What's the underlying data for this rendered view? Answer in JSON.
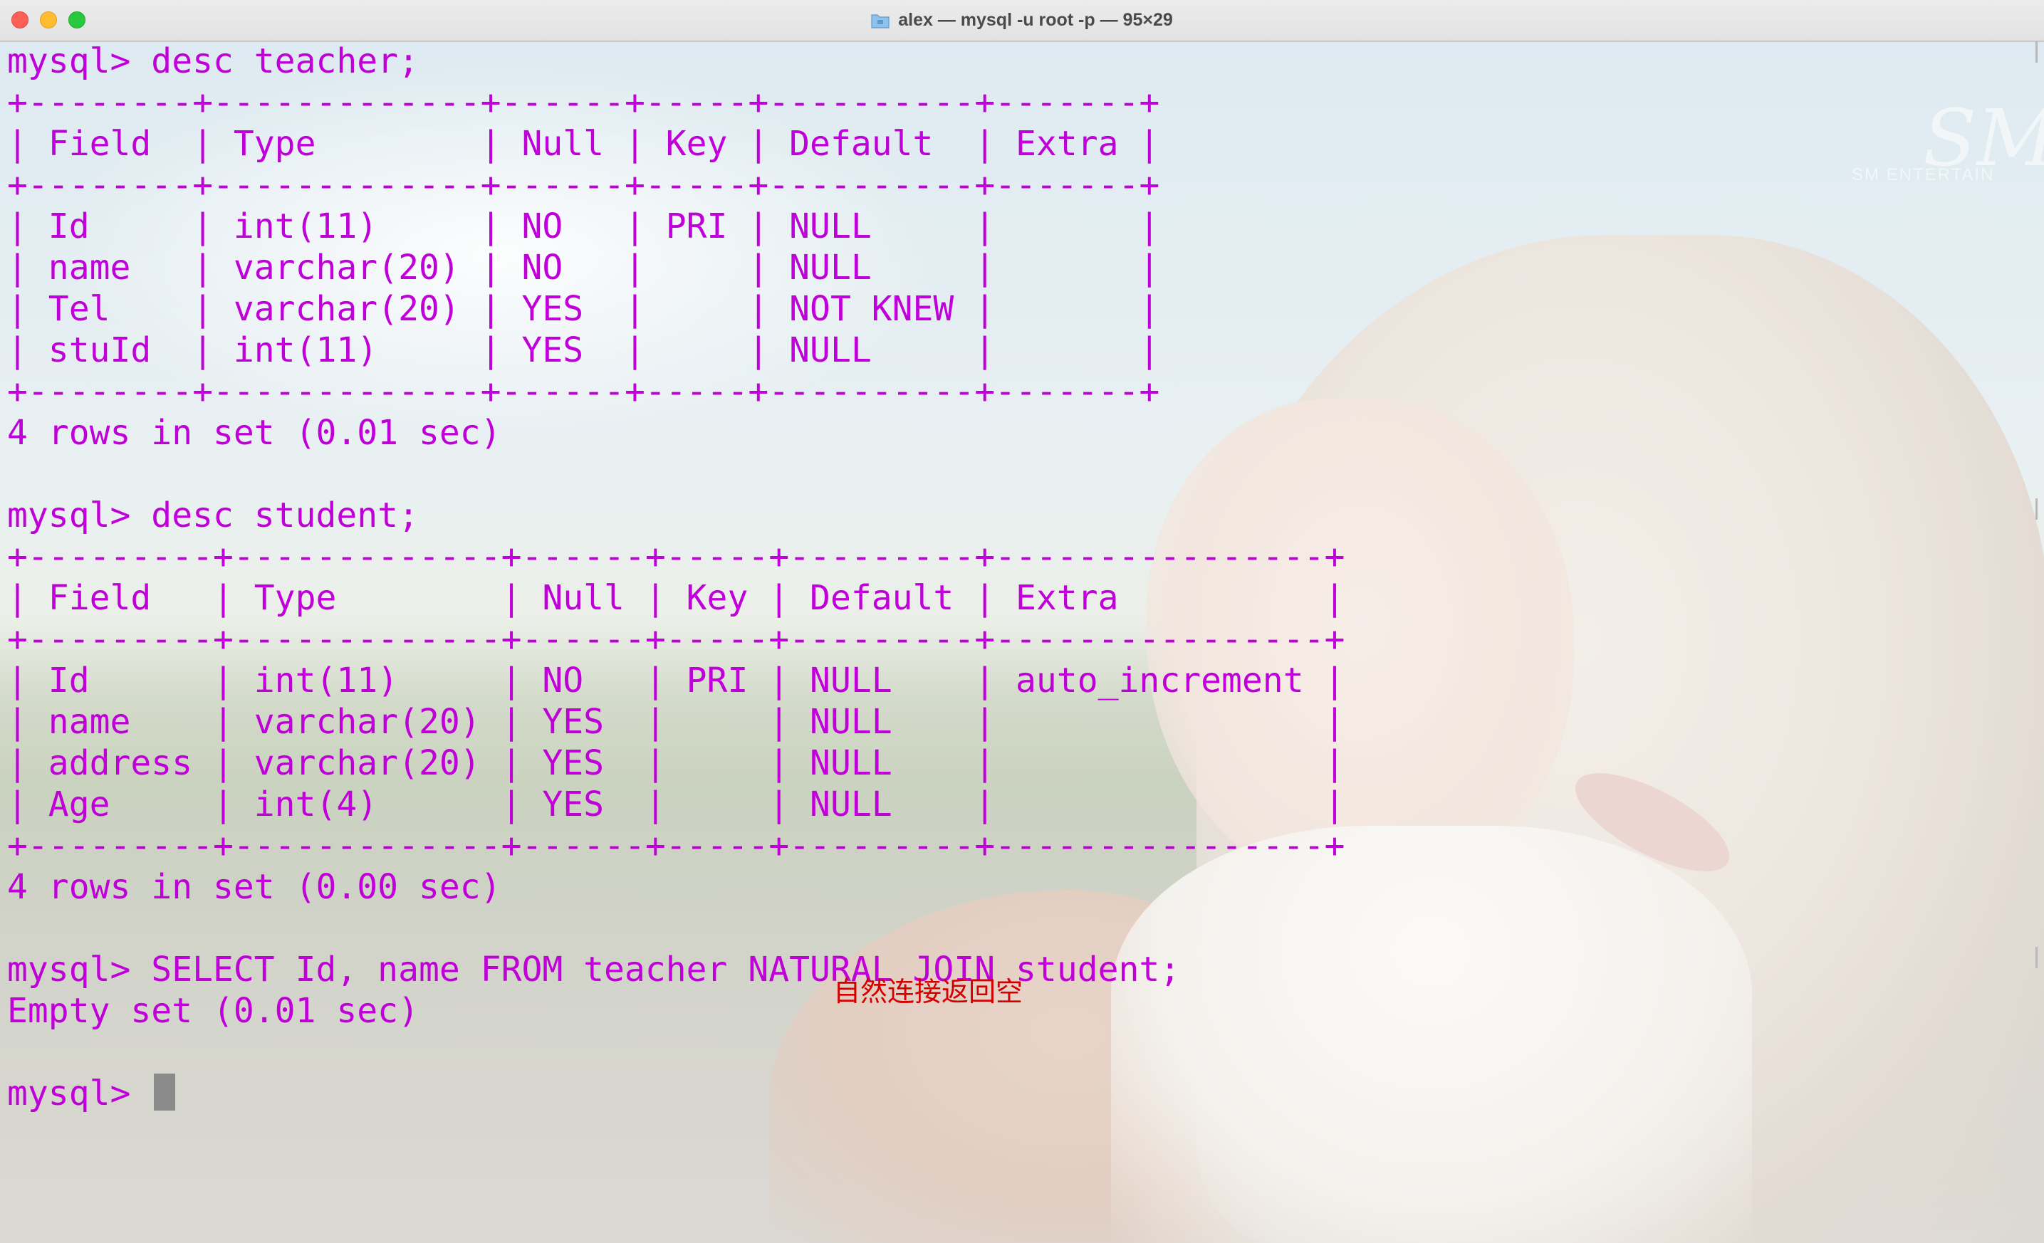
{
  "window": {
    "title": "alex — mysql -u root -p — 95×29",
    "icon": "folder-icon",
    "watermark": "SM",
    "watermark_sub": "SM ENTERTAIN"
  },
  "terminal": {
    "text_color": "#c000d8",
    "lines": [
      "mysql> desc teacher;",
      "+--------+-------------+------+-----+----------+-------+",
      "| Field  | Type        | Null | Key | Default  | Extra |",
      "+--------+-------------+------+-----+----------+-------+",
      "| Id     | int(11)     | NO   | PRI | NULL     |       |",
      "| name   | varchar(20) | NO   |     | NULL     |       |",
      "| Tel    | varchar(20) | YES  |     | NOT KNEW |       |",
      "| stuId  | int(11)     | YES  |     | NULL     |       |",
      "+--------+-------------+------+-----+----------+-------+",
      "4 rows in set (0.01 sec)",
      "",
      "mysql> desc student;",
      "+---------+-------------+------+-----+---------+----------------+",
      "| Field   | Type        | Null | Key | Default | Extra          |",
      "+---------+-------------+------+-----+---------+----------------+",
      "| Id      | int(11)     | NO   | PRI | NULL    | auto_increment |",
      "| name    | varchar(20) | YES  |     | NULL    |                |",
      "| address | varchar(20) | YES  |     | NULL    |                |",
      "| Age     | int(4)      | YES  |     | NULL    |                |",
      "+---------+-------------+------+-----+---------+----------------+",
      "4 rows in set (0.00 sec)",
      "",
      "mysql> SELECT Id, name FROM teacher NATURAL JOIN student;",
      "Empty set (0.01 sec)",
      "",
      "mysql> "
    ]
  },
  "annotation": {
    "text": "自然连接返回空",
    "color": "#d40000"
  }
}
